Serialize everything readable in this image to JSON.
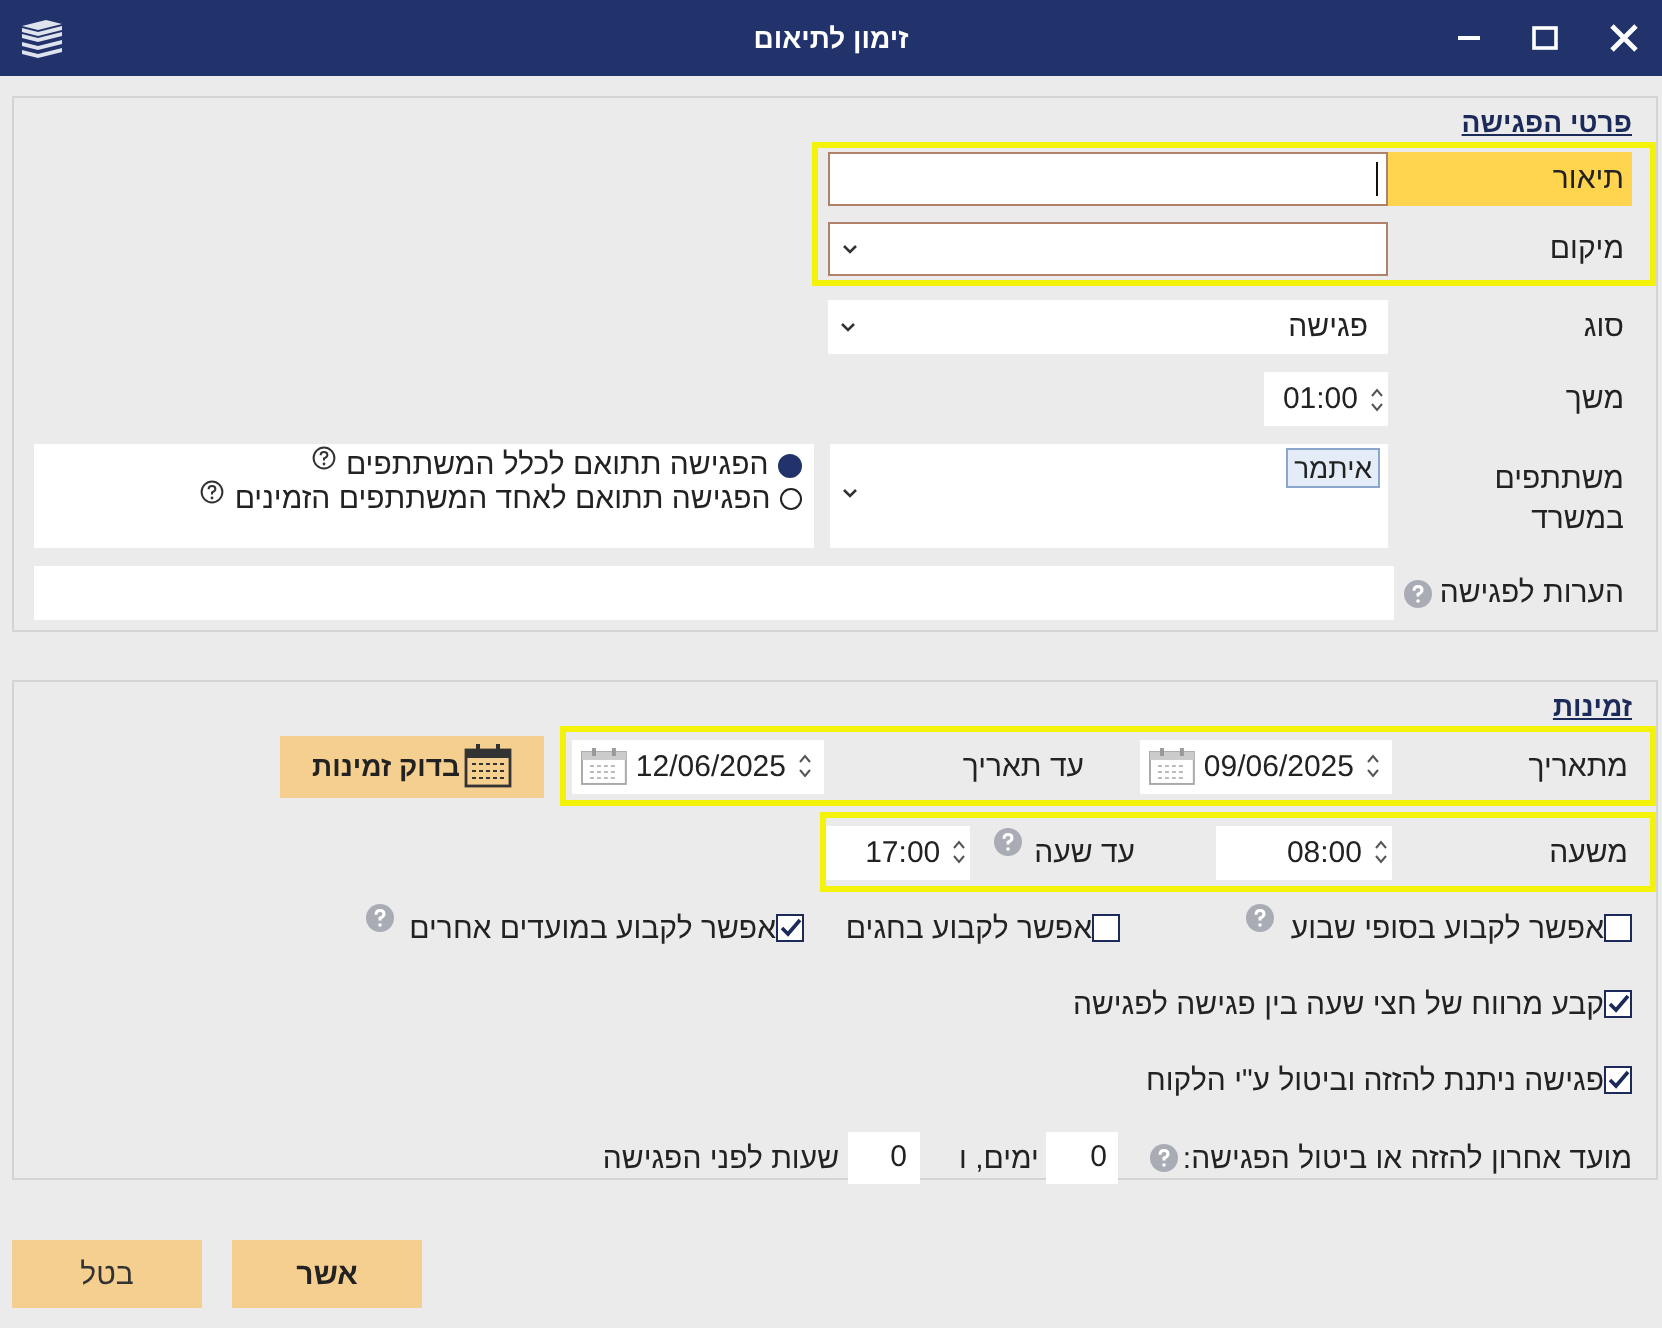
{
  "window": {
    "title": "זימון לתיאום"
  },
  "details": {
    "legend": "פרטי הפגישה",
    "description": {
      "label": "תיאור",
      "focused": true
    },
    "location": {
      "label": "מיקום"
    },
    "type": {
      "label": "סוג",
      "value": "פגישה"
    },
    "duration": {
      "label": "משך",
      "value": "01:00"
    },
    "participants": {
      "label": "משתתפים במשרד",
      "chips": [
        "איתמר"
      ],
      "options": [
        {
          "label": "הפגישה תתואם לכלל המשתתפים",
          "selected": true
        },
        {
          "label": "הפגישה תתואם לאחד המשתתפים הזמינים",
          "selected": false
        }
      ]
    },
    "notes": {
      "label": "הערות לפגישה"
    }
  },
  "availability": {
    "legend": "זמינות",
    "from_date": {
      "label": "מתאריך",
      "value": "09/06/2025"
    },
    "to_date": {
      "label": "עד תאריך",
      "value": "12/06/2025"
    },
    "check_button": "בדוק זמינות",
    "from_time": {
      "label": "משעה",
      "value": "08:00"
    },
    "to_time": {
      "label": "עד שעה",
      "value": "17:00"
    },
    "checkbox_row": [
      {
        "label": "אפשר לקבוע בסופי שבוע",
        "checked": false,
        "help": true
      },
      {
        "label": "אפשר לקבוע בחגים",
        "checked": false,
        "help": false
      },
      {
        "label": "אפשר לקבוע במועדים אחרים",
        "checked": true,
        "help": true
      }
    ],
    "checkboxes": [
      {
        "label": "קבע מרווח של חצי שעה בין פגישה לפגישה",
        "checked": true
      },
      {
        "label": "פגישה ניתנת להזזה וביטול ע\"י הלקוח",
        "checked": true
      }
    ],
    "deadline": {
      "label": "מועד אחרון להזזה או ביטול הפגישה:",
      "days": "0",
      "days_unit": "ימים, ו",
      "hours": "0",
      "hours_unit": "שעות לפני הפגישה"
    }
  },
  "buttons": [
    {
      "label": "אשר"
    },
    {
      "label": "בטל"
    }
  ]
}
